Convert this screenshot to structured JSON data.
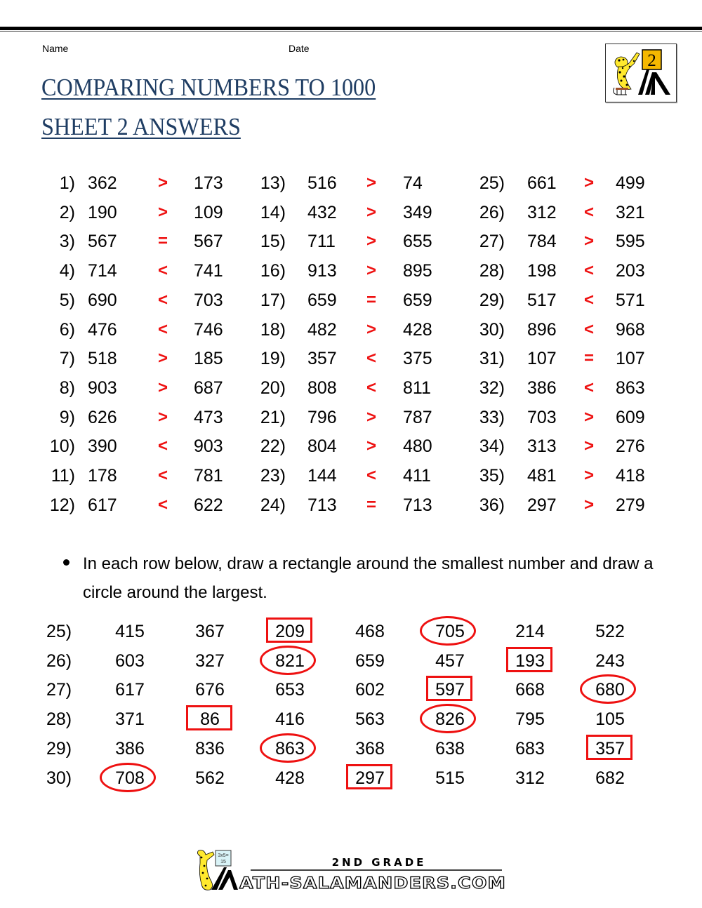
{
  "header": {
    "name_label": "Name",
    "date_label": "Date",
    "title_line1": "COMPARING NUMBERS TO 1000",
    "title_line2": "SHEET 2 ANSWERS",
    "logo_badge": "2"
  },
  "colors": {
    "title": "#1f3d63",
    "answer_mark": "#ee1111"
  },
  "comparisons": [
    {
      "n": "1)",
      "a": "362",
      "sym": ">",
      "b": "173"
    },
    {
      "n": "2)",
      "a": "190",
      "sym": ">",
      "b": "109"
    },
    {
      "n": "3)",
      "a": "567",
      "sym": "=",
      "b": "567"
    },
    {
      "n": "4)",
      "a": "714",
      "sym": "<",
      "b": "741"
    },
    {
      "n": "5)",
      "a": "690",
      "sym": "<",
      "b": "703"
    },
    {
      "n": "6)",
      "a": "476",
      "sym": "<",
      "b": "746"
    },
    {
      "n": "7)",
      "a": "518",
      "sym": ">",
      "b": "185"
    },
    {
      "n": "8)",
      "a": "903",
      "sym": ">",
      "b": "687"
    },
    {
      "n": "9)",
      "a": "626",
      "sym": ">",
      "b": "473"
    },
    {
      "n": "10)",
      "a": "390",
      "sym": "<",
      "b": "903"
    },
    {
      "n": "11)",
      "a": "178",
      "sym": "<",
      "b": "781"
    },
    {
      "n": "12)",
      "a": "617",
      "sym": "<",
      "b": "622"
    },
    {
      "n": "13)",
      "a": "516",
      "sym": ">",
      "b": "74"
    },
    {
      "n": "14)",
      "a": "432",
      "sym": ">",
      "b": "349"
    },
    {
      "n": "15)",
      "a": "711",
      "sym": ">",
      "b": "655"
    },
    {
      "n": "16)",
      "a": "913",
      "sym": ">",
      "b": "895"
    },
    {
      "n": "17)",
      "a": "659",
      "sym": "=",
      "b": "659"
    },
    {
      "n": "18)",
      "a": "482",
      "sym": ">",
      "b": "428"
    },
    {
      "n": "19)",
      "a": "357",
      "sym": "<",
      "b": "375"
    },
    {
      "n": "20)",
      "a": "808",
      "sym": "<",
      "b": "811"
    },
    {
      "n": "21)",
      "a": "796",
      "sym": ">",
      "b": "787"
    },
    {
      "n": "22)",
      "a": "804",
      "sym": ">",
      "b": "480"
    },
    {
      "n": "23)",
      "a": "144",
      "sym": "<",
      "b": "411"
    },
    {
      "n": "24)",
      "a": "713",
      "sym": "=",
      "b": "713"
    },
    {
      "n": "25)",
      "a": "661",
      "sym": ">",
      "b": "499"
    },
    {
      "n": "26)",
      "a": "312",
      "sym": "<",
      "b": "321"
    },
    {
      "n": "27)",
      "a": "784",
      "sym": ">",
      "b": "595"
    },
    {
      "n": "28)",
      "a": "198",
      "sym": "<",
      "b": "203"
    },
    {
      "n": "29)",
      "a": "517",
      "sym": "<",
      "b": "571"
    },
    {
      "n": "30)",
      "a": "896",
      "sym": "<",
      "b": "968"
    },
    {
      "n": "31)",
      "a": "107",
      "sym": "=",
      "b": "107"
    },
    {
      "n": "32)",
      "a": "386",
      "sym": "<",
      "b": "863"
    },
    {
      "n": "33)",
      "a": "703",
      "sym": ">",
      "b": "609"
    },
    {
      "n": "34)",
      "a": "313",
      "sym": ">",
      "b": "276"
    },
    {
      "n": "35)",
      "a": "481",
      "sym": ">",
      "b": "418"
    },
    {
      "n": "36)",
      "a": "297",
      "sym": ">",
      "b": "279"
    }
  ],
  "instruction": "In each row below, draw a rectangle around the smallest number and draw a circle around the largest.",
  "ordering": [
    {
      "n": "25)",
      "values": [
        "415",
        "367",
        "209",
        "468",
        "705",
        "214",
        "522"
      ],
      "smallest_index": 2,
      "largest_index": 4
    },
    {
      "n": "26)",
      "values": [
        "603",
        "327",
        "821",
        "659",
        "457",
        "193",
        "243"
      ],
      "smallest_index": 5,
      "largest_index": 2
    },
    {
      "n": "27)",
      "values": [
        "617",
        "676",
        "653",
        "602",
        "597",
        "668",
        "680"
      ],
      "smallest_index": 4,
      "largest_index": 6
    },
    {
      "n": "28)",
      "values": [
        "371",
        "86",
        "416",
        "563",
        "826",
        "795",
        "105"
      ],
      "smallest_index": 1,
      "largest_index": 4
    },
    {
      "n": "29)",
      "values": [
        "386",
        "836",
        "863",
        "368",
        "638",
        "683",
        "357"
      ],
      "smallest_index": 6,
      "largest_index": 2
    },
    {
      "n": "30)",
      "values": [
        "708",
        "562",
        "428",
        "297",
        "515",
        "312",
        "682"
      ],
      "smallest_index": 3,
      "largest_index": 0
    }
  ],
  "footer": {
    "grade_text": "2ND GRADE",
    "site_text": "ATH-SALAMANDERS.COM",
    "board_text_1": "3x5=",
    "board_text_2": "15"
  }
}
